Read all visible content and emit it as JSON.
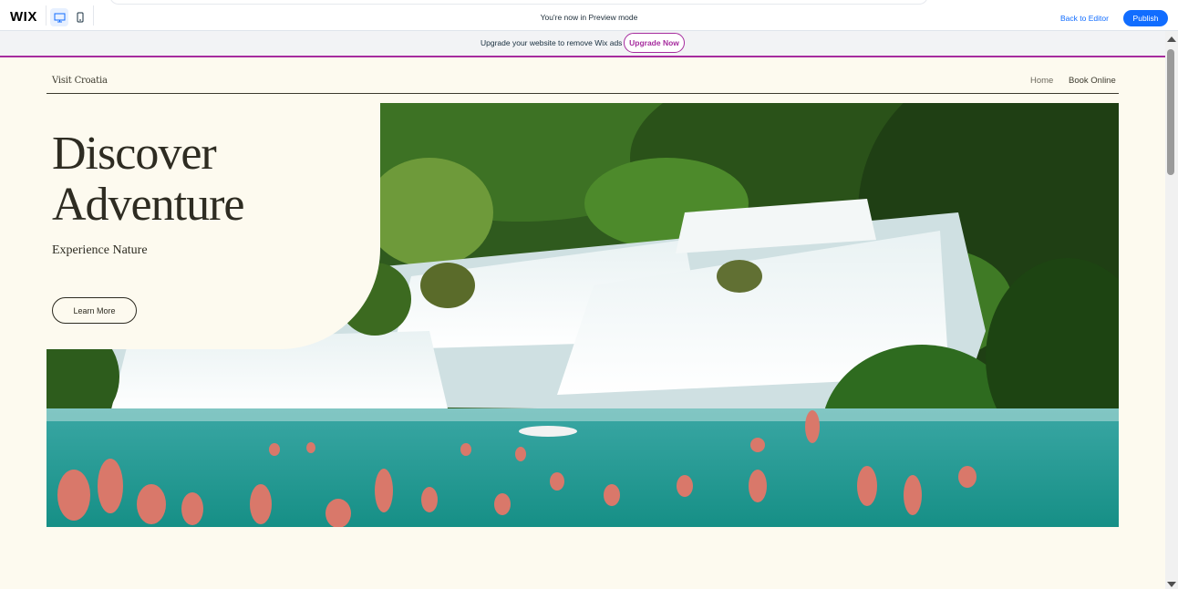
{
  "editor": {
    "logo": "WIX",
    "preview_text": "You're now in Preview mode",
    "back_to_editor": "Back to Editor",
    "publish": "Publish",
    "devices": [
      "desktop-icon",
      "mobile-icon"
    ],
    "accent": "#116dff"
  },
  "banner": {
    "text": "Upgrade your website to remove Wix ads",
    "button": "Upgrade Now",
    "accent": "#a62c9e"
  },
  "site": {
    "name": "Visit Croatia",
    "nav": [
      "Home",
      "Book Online"
    ],
    "background": "#fdfaef",
    "hero": {
      "title_line1": "Discover",
      "title_line2": "Adventure",
      "subtitle": "Experience Nature",
      "button": "Learn More"
    }
  }
}
